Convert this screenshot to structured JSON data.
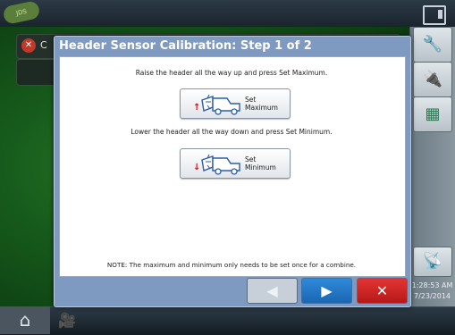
{
  "header": {
    "logo_text": "JDS",
    "window_icon": "window-toggle-icon"
  },
  "background": {
    "pane_letter": "C",
    "error_icon": "error-x-icon"
  },
  "sidebar": {
    "items": [
      {
        "icon": "wrench-icon",
        "glyph": "🔧"
      },
      {
        "icon": "sensor-icon",
        "glyph": "🔌"
      },
      {
        "icon": "calendar-icon",
        "glyph": "▦"
      },
      {
        "icon": "satellite-icon",
        "glyph": "📡"
      }
    ],
    "time": "1:28:53 AM",
    "date": "7/23/2014"
  },
  "bottom": {
    "home_icon": "home-icon",
    "home_glyph": "⌂",
    "camera_icon": "camera-icon",
    "camera_glyph": "🎥"
  },
  "dialog": {
    "title": "Header Sensor Calibration:  Step 1 of 2",
    "raise_instruction": "Raise the header all the way up and press Set Maximum.",
    "lower_instruction": "Lower the header all the way down and press Set Minimum.",
    "set_max_line1": "Set",
    "set_max_line2": "Maximum",
    "set_min_line1": "Set",
    "set_min_line2": "Minimum",
    "note": "NOTE:  The maximum and minimum only needs to be set once for a combine.",
    "back_glyph": "◀",
    "next_glyph": "▶",
    "cancel_glyph": "✕"
  },
  "colors": {
    "dialog_frame": "#7f9ac0",
    "next": "#1a66b3",
    "cancel": "#d02020",
    "arrow": "#dd1111"
  }
}
